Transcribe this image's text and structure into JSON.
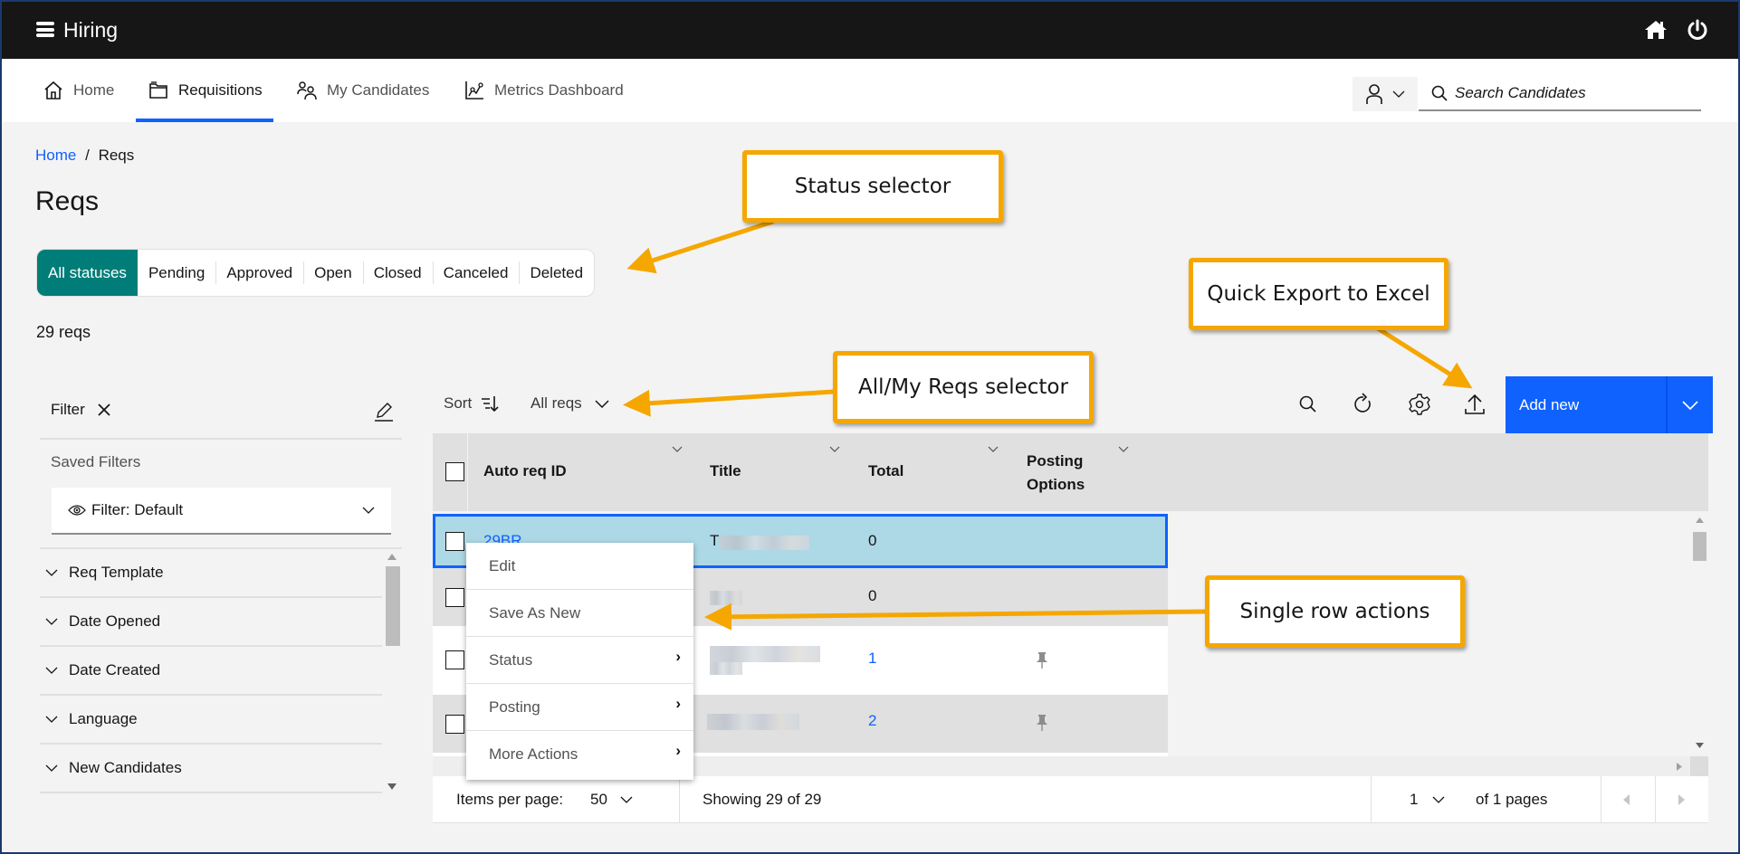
{
  "app": {
    "title": "Hiring",
    "icons": {
      "menu": "hamburger-menu-icon",
      "home": "home-icon",
      "power": "power-icon"
    }
  },
  "nav": {
    "items": [
      {
        "label": "Home",
        "icon": "home-outline-icon",
        "active": false
      },
      {
        "label": "Requisitions",
        "icon": "folder-icon",
        "active": true
      },
      {
        "label": "My Candidates",
        "icon": "people-icon",
        "active": false
      },
      {
        "label": "Metrics Dashboard",
        "icon": "chart-icon",
        "active": false
      }
    ],
    "search_placeholder": "Search Candidates"
  },
  "breadcrumb": {
    "home": "Home",
    "separator": "/",
    "current": "Reqs"
  },
  "page_title": "Reqs",
  "status_tabs": {
    "active": "All statuses",
    "items": [
      "All statuses",
      "Pending",
      "Approved",
      "Open",
      "Closed",
      "Canceled",
      "Deleted"
    ]
  },
  "req_count": "29 reqs",
  "filter": {
    "title": "Filter",
    "saved_label": "Saved Filters",
    "saved_value": "Filter: Default",
    "facets": [
      "Req Template",
      "Date Opened",
      "Date Created",
      "Language",
      "New Candidates"
    ]
  },
  "toolbar": {
    "sort_label": "Sort",
    "scope_value": "All reqs",
    "add_new_label": "Add new",
    "accent_color": "#0f62fe"
  },
  "table": {
    "columns": [
      "Auto req ID",
      "Title",
      "Total",
      "Posting Options"
    ],
    "rows": [
      {
        "id": "29BR",
        "title": "T",
        "total": "0",
        "pinned": false,
        "selected": true
      },
      {
        "id": "",
        "title": "",
        "total": "0",
        "pinned": false,
        "selected": false
      },
      {
        "id": "",
        "title": "",
        "total": "1",
        "pinned": true,
        "selected": false
      },
      {
        "id": "",
        "title": "",
        "total": "2",
        "pinned": true,
        "selected": false
      }
    ]
  },
  "row_menu": {
    "items": [
      {
        "label": "Edit",
        "submenu": false
      },
      {
        "label": "Save As New",
        "submenu": false
      },
      {
        "label": "Status",
        "submenu": true
      },
      {
        "label": "Posting",
        "submenu": true
      },
      {
        "label": "More Actions",
        "submenu": true
      }
    ]
  },
  "pagination": {
    "items_per_page_label": "Items per page:",
    "items_per_page": "50",
    "showing": "Showing 29 of 29",
    "page": "1",
    "of_pages": "of 1 pages"
  },
  "callouts": {
    "status": "Status selector",
    "export": "Quick Export to Excel",
    "scope": "All/My Reqs selector",
    "row_actions": "Single row actions",
    "color": "#f5a700"
  }
}
